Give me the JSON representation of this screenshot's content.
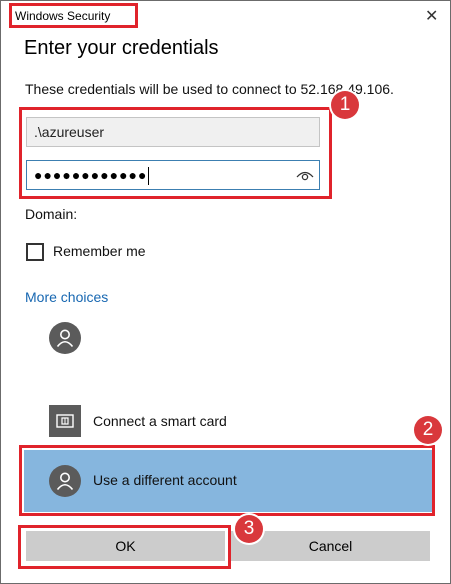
{
  "window": {
    "title": "Windows Security",
    "close_glyph": "✕"
  },
  "heading": "Enter your credentials",
  "description": "These credentials will be used to connect to 52.168.49.106.",
  "username_field": {
    "value": ".\\azureuser"
  },
  "password_field": {
    "masked_value": "●●●●●●●●●●●●",
    "icon": "eye-icon"
  },
  "domain_label": "Domain:",
  "remember_me": {
    "label": "Remember me",
    "checked": false
  },
  "more_choices_link": "More choices",
  "choices": [
    {
      "icon": "user-avatar-icon",
      "label": ""
    },
    {
      "icon": "smart-card-icon",
      "label": "Connect a smart card"
    },
    {
      "icon": "user-avatar-icon",
      "label": "Use a different account",
      "selected": true
    }
  ],
  "buttons": {
    "ok": "OK",
    "cancel": "Cancel"
  },
  "annotations": {
    "badge_1": "1",
    "badge_2": "2",
    "badge_3": "3",
    "color": "#e0232b"
  },
  "colors": {
    "selected_row": "#86b6de",
    "link": "#1767b1",
    "focus_border": "#3c7fb1"
  }
}
